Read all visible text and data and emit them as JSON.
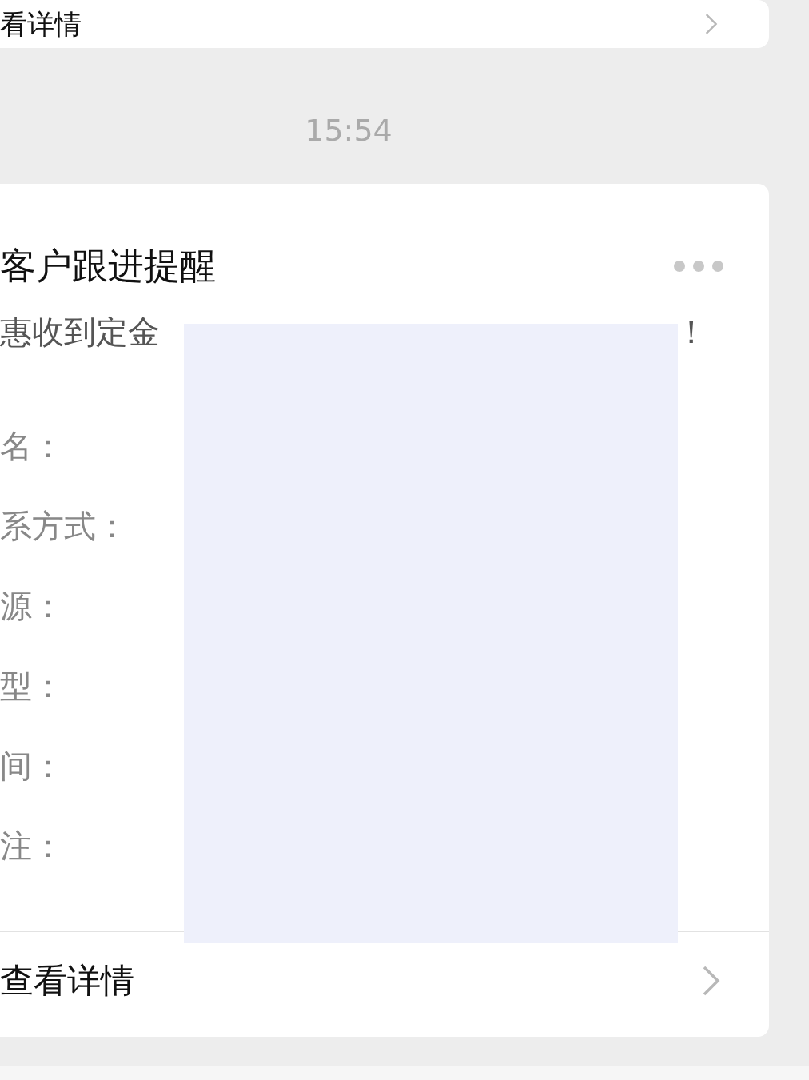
{
  "top_card": {
    "link": "看详情"
  },
  "timestamp": "15:54",
  "card": {
    "title": "客户跟进提醒",
    "subtitle": "惠收到定金",
    "subtitle_end": "！",
    "fields": [
      {
        "label": "名："
      },
      {
        "label": "系方式："
      },
      {
        "label": "源："
      },
      {
        "label": "型："
      },
      {
        "label": "间："
      },
      {
        "label": "注："
      }
    ],
    "link": "查看详情"
  }
}
